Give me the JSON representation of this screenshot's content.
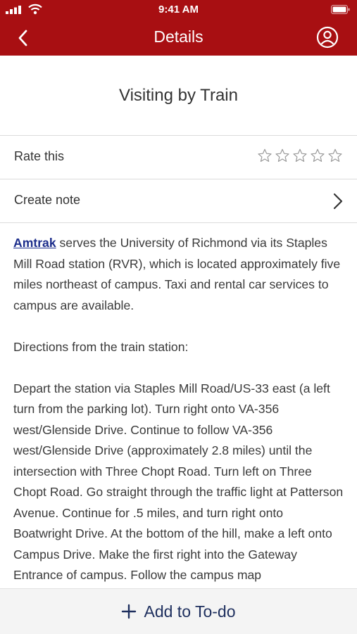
{
  "status_bar": {
    "time": "9:41 AM"
  },
  "nav": {
    "title": "Details"
  },
  "page": {
    "title": "Visiting by Train"
  },
  "rate": {
    "label": "Rate this",
    "stars_filled": 0,
    "stars_total": 5
  },
  "note": {
    "label": "Create note"
  },
  "content": {
    "p1_link": "Amtrak",
    "p1_rest": " serves the University of Richmond via its Staples Mill Road station (RVR), which is located approximately five miles northeast of campus. Taxi and rental car services to campus are available.",
    "p2": "Directions from the train station:",
    "p3": "Depart the station via Staples Mill Road/US-33 east (a left turn from the parking lot). Turn right onto VA-356 west/Glenside Drive. Continue to follow VA-356 west/Glenside Drive (approximately 2.8 miles) until the intersection with Three Chopt Road. Turn left on Three Chopt Road. Go straight through the traffic light at Patterson Avenue. Continue for .5 miles, and turn right onto Boatwright Drive. At the bottom of the hill, make a left onto Campus Drive. Make the first right into the Gateway Entrance of campus. Follow the campus map"
  },
  "bottom": {
    "add_label": "Add to To-do"
  },
  "colors": {
    "header": "#a80f12",
    "link": "#1d2e8c",
    "bottom_text": "#1e2f5e"
  }
}
